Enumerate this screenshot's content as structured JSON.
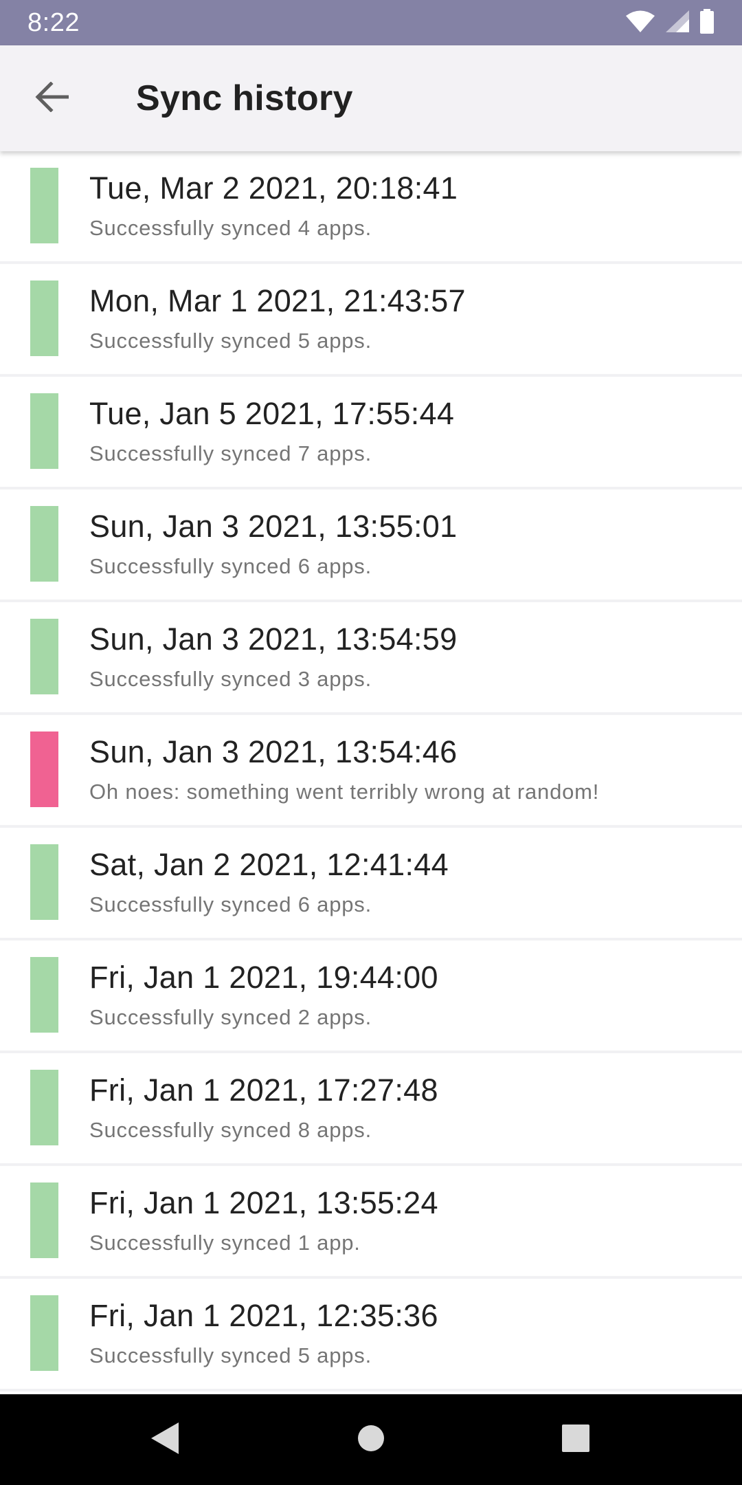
{
  "status_bar": {
    "time": "8:22",
    "icons": [
      "wifi-icon",
      "cellular-signal-icon",
      "battery-icon"
    ]
  },
  "app_bar": {
    "title": "Sync history",
    "back_icon": "arrow-back-icon"
  },
  "colors": {
    "success": "#a5d8a7",
    "error": "#f06292",
    "status_bar_bg": "#8482a5",
    "app_bar_bg": "#f3f2f5"
  },
  "history": [
    {
      "timestamp": "Tue, Mar 2 2021, 20:18:41",
      "message": "Successfully synced 4 apps.",
      "status": "success"
    },
    {
      "timestamp": "Mon, Mar 1 2021, 21:43:57",
      "message": "Successfully synced 5 apps.",
      "status": "success"
    },
    {
      "timestamp": "Tue, Jan 5 2021, 17:55:44",
      "message": "Successfully synced 7 apps.",
      "status": "success"
    },
    {
      "timestamp": "Sun, Jan 3 2021, 13:55:01",
      "message": "Successfully synced 6 apps.",
      "status": "success"
    },
    {
      "timestamp": "Sun, Jan 3 2021, 13:54:59",
      "message": "Successfully synced 3 apps.",
      "status": "success"
    },
    {
      "timestamp": "Sun, Jan 3 2021, 13:54:46",
      "message": "Oh noes: something went terribly wrong at random!",
      "status": "error"
    },
    {
      "timestamp": "Sat, Jan 2 2021, 12:41:44",
      "message": "Successfully synced 6 apps.",
      "status": "success"
    },
    {
      "timestamp": "Fri, Jan 1 2021, 19:44:00",
      "message": "Successfully synced 2 apps.",
      "status": "success"
    },
    {
      "timestamp": "Fri, Jan 1 2021, 17:27:48",
      "message": "Successfully synced 8 apps.",
      "status": "success"
    },
    {
      "timestamp": "Fri, Jan 1 2021, 13:55:24",
      "message": "Successfully synced 1 app.",
      "status": "success"
    },
    {
      "timestamp": "Fri, Jan 1 2021, 12:35:36",
      "message": "Successfully synced 5 apps.",
      "status": "success"
    }
  ],
  "nav_bar": {
    "icons": [
      "nav-back-icon",
      "nav-home-icon",
      "nav-recents-icon"
    ]
  }
}
